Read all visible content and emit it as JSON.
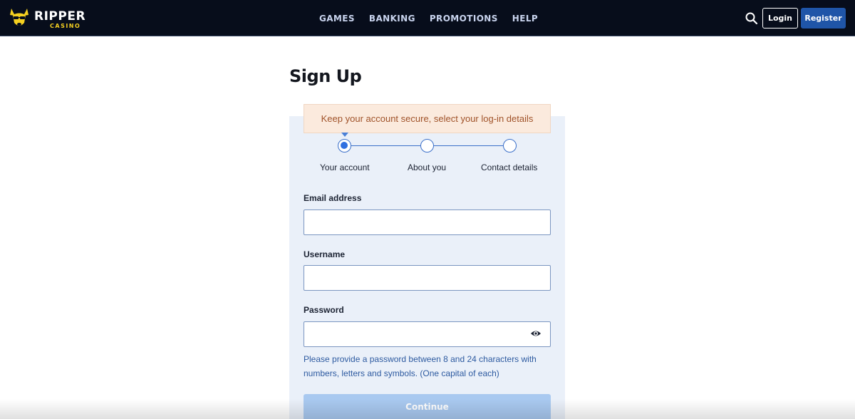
{
  "header": {
    "logo_text": "RIPPER",
    "logo_sub": "CASINO",
    "nav": [
      "GAMES",
      "BANKING",
      "PROMOTIONS",
      "HELP"
    ],
    "login_label": "Login",
    "register_label": "Register",
    "icons": {
      "search": "search-icon",
      "logo": "kangaroo-logo-icon"
    },
    "colors": {
      "background": "#070d1b",
      "accent": "#1f55a8",
      "logo_yellow": "#f5d020"
    }
  },
  "main": {
    "title": "Sign Up",
    "notice": "Keep your account secure, select your log-in details",
    "steps": [
      {
        "label": "Your account",
        "active": true
      },
      {
        "label": "About you",
        "active": false
      },
      {
        "label": "Contact details",
        "active": false
      }
    ],
    "fields": {
      "email": {
        "label": "Email address",
        "value": "",
        "placeholder": ""
      },
      "username": {
        "label": "Username",
        "value": "",
        "placeholder": ""
      },
      "password": {
        "label": "Password",
        "value": "",
        "placeholder": "",
        "icon": "eye-icon"
      }
    },
    "password_hint": "Please provide a password between 8 and 24 characters with numbers, letters and symbols. (One capital of each)",
    "continue_label": "Continue",
    "colors": {
      "panel": "#eaf0f9",
      "notice_bg": "#fbeadd",
      "notice_text": "#a0532a",
      "hint_text": "#2d5aa0",
      "button_disabled": "#a9c9f0"
    }
  }
}
